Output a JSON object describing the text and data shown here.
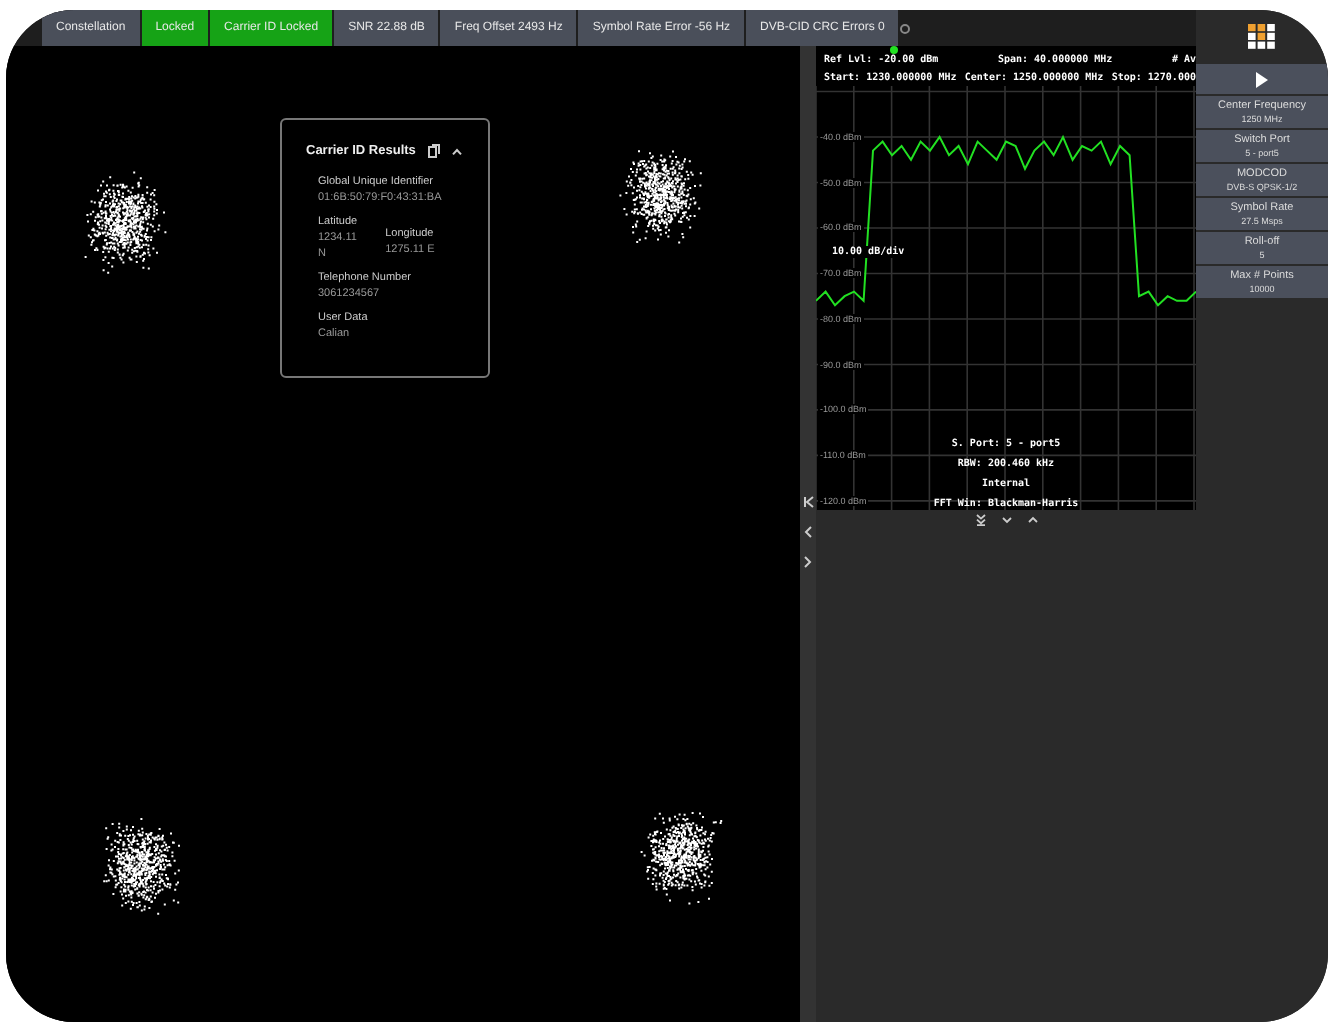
{
  "status_tabs": [
    {
      "label": "Constellation",
      "color": "#4a4f5a"
    },
    {
      "label": "Locked",
      "color": "#16a316"
    },
    {
      "label": "Carrier ID Locked",
      "color": "#16a316"
    },
    {
      "label": "SNR 22.88 dB",
      "color": "#4a4f5a"
    },
    {
      "label": "Freq Offset 2493 Hz",
      "color": "#4a4f5a"
    },
    {
      "label": "Symbol Rate Error -56 Hz",
      "color": "#4a4f5a"
    },
    {
      "label": "DVB-CID CRC Errors 0",
      "color": "#4a4f5a"
    }
  ],
  "carrier_card": {
    "title": "Carrier ID Results",
    "identifier": {
      "label": "Global Unique Identifier",
      "value": "01:6B:50:79:F0:43:31:BA"
    },
    "latitude": {
      "label": "Latitude",
      "lines": [
        "1234.11",
        "N"
      ]
    },
    "longitude": {
      "label": "Longitude",
      "lines": [
        "1275.11 E"
      ]
    },
    "telephone": {
      "label": "Telephone Number",
      "value": "3061234567"
    },
    "user_data": {
      "label": "User Data",
      "value": "Calian"
    }
  },
  "spectrum": {
    "ref_level": "Ref Lvl: -20.00 dBm",
    "span": "Span: 40.000000 MHz",
    "avg": "# Av",
    "start": "Start: 1230.000000 MHz",
    "center": "Center: 1250.000000 MHz",
    "stop": "Stop: 1270.000",
    "scale": "10.00 dB/div",
    "chart_data": {
      "type": "line",
      "grid": true,
      "ylim": [
        -122,
        -20
      ],
      "categories": [
        null,
        null,
        null,
        null,
        null,
        null,
        null,
        null,
        null,
        null,
        null,
        null,
        null,
        null,
        null,
        null,
        null,
        null,
        null,
        null,
        null,
        null,
        null,
        null,
        null,
        null,
        null,
        null,
        null,
        null,
        null,
        null,
        null,
        null,
        null,
        null,
        null,
        null,
        null,
        null,
        null
      ],
      "series": [
        {
          "color": "#22e022",
          "values": [
            -76,
            -74,
            -77,
            -75,
            -74,
            -76,
            -43,
            -41,
            -44,
            -42,
            -45,
            -41,
            -43,
            -40,
            -44,
            -42,
            -46,
            -41,
            -43,
            -45,
            -41,
            -42,
            -47,
            -43,
            -41,
            -44,
            -40,
            -45,
            -42,
            -43,
            -41,
            -46,
            -42,
            -44,
            -75,
            -74,
            -77,
            -75,
            -76,
            -76,
            -74
          ]
        }
      ],
      "yticks": [
        {
          "value": -40,
          "label": "-40.0 dBm"
        },
        {
          "value": -50,
          "label": "-50.0 dBm"
        },
        {
          "value": -60,
          "label": "-60.0 dBm"
        },
        {
          "value": -70,
          "label": "-70.0 dBm"
        },
        {
          "value": -80,
          "label": "-80.0 dBm"
        },
        {
          "value": -90,
          "label": "-90.0 dBm"
        },
        {
          "value": -100,
          "label": "-100.0 dBm"
        },
        {
          "value": -110,
          "label": "-110.0 dBm"
        },
        {
          "value": -120,
          "label": "-120.0 dBm"
        }
      ]
    },
    "info": [
      "S. Port: 5 - port5",
      "RBW: 200.460 kHz",
      "Internal",
      "FFT Win: Blackman-Harris"
    ]
  },
  "sidebar": {
    "items": [
      {
        "label": "Center Frequency",
        "value": "1250 MHz"
      },
      {
        "label": "Switch Port",
        "value": "5 - port5"
      },
      {
        "label": "MODCOD",
        "value": "DVB-S QPSK-1/2"
      },
      {
        "label": "Symbol Rate",
        "value": "27.5 Msps"
      },
      {
        "label": "Roll-off",
        "value": "5"
      },
      {
        "label": "Max # Points",
        "value": "10000"
      }
    ]
  }
}
